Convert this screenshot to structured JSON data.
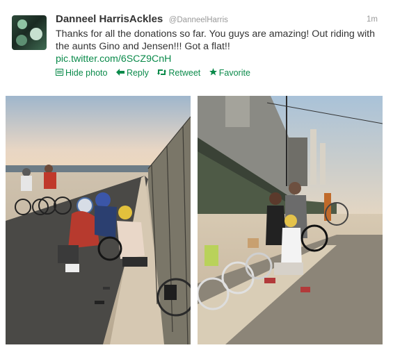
{
  "tweet": {
    "author_name": "Danneel HarrisAckles",
    "handle": "@DanneelHarris",
    "time": "1m",
    "text": "Thanks for all the donations so far. You guys are amazing! Out riding with the aunts Gino and Jensen!!! Got a flat!!",
    "link": "pic.twitter.com/6SCZ9CnH"
  },
  "actions": {
    "hide_photo": "Hide photo",
    "reply": "Reply",
    "retweet": "Retweet",
    "favorite": "Favorite"
  },
  "icons": {
    "hide_photo": "photo-icon",
    "reply": "reply-arrow-icon",
    "retweet": "retweet-icon",
    "favorite": "star-icon"
  },
  "colors": {
    "link": "#0a8a4a",
    "text": "#333333",
    "muted": "#999999"
  }
}
